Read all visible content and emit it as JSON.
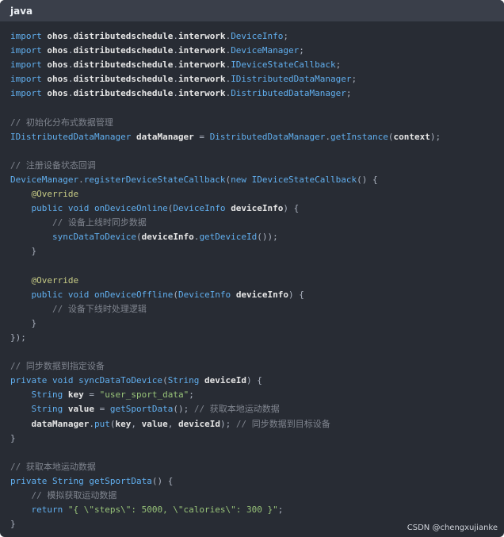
{
  "lang_label": "java",
  "watermark": "CSDN @chengxujianke",
  "code_lines": [
    [
      [
        "kw2",
        "import "
      ],
      [
        "pkg",
        "ohos"
      ],
      [
        "plain",
        "."
      ],
      [
        "pkg",
        "distributedschedule"
      ],
      [
        "plain",
        "."
      ],
      [
        "pkg",
        "interwork"
      ],
      [
        "plain",
        "."
      ],
      [
        "type",
        "DeviceInfo"
      ],
      [
        "plain",
        ";"
      ]
    ],
    [
      [
        "kw2",
        "import "
      ],
      [
        "pkg",
        "ohos"
      ],
      [
        "plain",
        "."
      ],
      [
        "pkg",
        "distributedschedule"
      ],
      [
        "plain",
        "."
      ],
      [
        "pkg",
        "interwork"
      ],
      [
        "plain",
        "."
      ],
      [
        "type",
        "DeviceManager"
      ],
      [
        "plain",
        ";"
      ]
    ],
    [
      [
        "kw2",
        "import "
      ],
      [
        "pkg",
        "ohos"
      ],
      [
        "plain",
        "."
      ],
      [
        "pkg",
        "distributedschedule"
      ],
      [
        "plain",
        "."
      ],
      [
        "pkg",
        "interwork"
      ],
      [
        "plain",
        "."
      ],
      [
        "type",
        "IDeviceStateCallback"
      ],
      [
        "plain",
        ";"
      ]
    ],
    [
      [
        "kw2",
        "import "
      ],
      [
        "pkg",
        "ohos"
      ],
      [
        "plain",
        "."
      ],
      [
        "pkg",
        "distributedschedule"
      ],
      [
        "plain",
        "."
      ],
      [
        "pkg",
        "interwork"
      ],
      [
        "plain",
        "."
      ],
      [
        "type",
        "IDistributedDataManager"
      ],
      [
        "plain",
        ";"
      ]
    ],
    [
      [
        "kw2",
        "import "
      ],
      [
        "pkg",
        "ohos"
      ],
      [
        "plain",
        "."
      ],
      [
        "pkg",
        "distributedschedule"
      ],
      [
        "plain",
        "."
      ],
      [
        "pkg",
        "interwork"
      ],
      [
        "plain",
        "."
      ],
      [
        "type",
        "DistributedDataManager"
      ],
      [
        "plain",
        ";"
      ]
    ],
    [],
    [
      [
        "com",
        "// 初始化分布式数据管理"
      ]
    ],
    [
      [
        "type",
        "IDistributedDataManager "
      ],
      [
        "var",
        "dataManager"
      ],
      [
        "plain",
        " = "
      ],
      [
        "type",
        "DistributedDataManager"
      ],
      [
        "plain",
        "."
      ],
      [
        "fn",
        "getInstance"
      ],
      [
        "plain",
        "("
      ],
      [
        "var",
        "context"
      ],
      [
        "plain",
        ");"
      ]
    ],
    [],
    [
      [
        "com",
        "// 注册设备状态回调"
      ]
    ],
    [
      [
        "type",
        "DeviceManager"
      ],
      [
        "plain",
        "."
      ],
      [
        "fn",
        "registerDeviceStateCallback"
      ],
      [
        "plain",
        "("
      ],
      [
        "kw2",
        "new "
      ],
      [
        "type",
        "IDeviceStateCallback"
      ],
      [
        "plain",
        "() {"
      ]
    ],
    [
      [
        "plain",
        "    "
      ],
      [
        "ann",
        "@Override"
      ]
    ],
    [
      [
        "plain",
        "    "
      ],
      [
        "kw2",
        "public void "
      ],
      [
        "fn",
        "onDeviceOnline"
      ],
      [
        "plain",
        "("
      ],
      [
        "type",
        "DeviceInfo "
      ],
      [
        "var",
        "deviceInfo"
      ],
      [
        "plain",
        ") {"
      ]
    ],
    [
      [
        "plain",
        "        "
      ],
      [
        "com",
        "// 设备上线时同步数据"
      ]
    ],
    [
      [
        "plain",
        "        "
      ],
      [
        "fn",
        "syncDataToDevice"
      ],
      [
        "plain",
        "("
      ],
      [
        "var",
        "deviceInfo"
      ],
      [
        "plain",
        "."
      ],
      [
        "fn",
        "getDeviceId"
      ],
      [
        "plain",
        "());"
      ]
    ],
    [
      [
        "plain",
        "    }"
      ]
    ],
    [],
    [
      [
        "plain",
        "    "
      ],
      [
        "ann",
        "@Override"
      ]
    ],
    [
      [
        "plain",
        "    "
      ],
      [
        "kw2",
        "public void "
      ],
      [
        "fn",
        "onDeviceOffline"
      ],
      [
        "plain",
        "("
      ],
      [
        "type",
        "DeviceInfo "
      ],
      [
        "var",
        "deviceInfo"
      ],
      [
        "plain",
        ") {"
      ]
    ],
    [
      [
        "plain",
        "        "
      ],
      [
        "com",
        "// 设备下线时处理逻辑"
      ]
    ],
    [
      [
        "plain",
        "    }"
      ]
    ],
    [
      [
        "plain",
        "});"
      ]
    ],
    [],
    [
      [
        "com",
        "// 同步数据到指定设备"
      ]
    ],
    [
      [
        "kw2",
        "private void "
      ],
      [
        "fn",
        "syncDataToDevice"
      ],
      [
        "plain",
        "("
      ],
      [
        "type",
        "String "
      ],
      [
        "var",
        "deviceId"
      ],
      [
        "plain",
        ") {"
      ]
    ],
    [
      [
        "plain",
        "    "
      ],
      [
        "type",
        "String "
      ],
      [
        "var",
        "key"
      ],
      [
        "plain",
        " = "
      ],
      [
        "str",
        "\"user_sport_data\""
      ],
      [
        "plain",
        ";"
      ]
    ],
    [
      [
        "plain",
        "    "
      ],
      [
        "type",
        "String "
      ],
      [
        "var",
        "value"
      ],
      [
        "plain",
        " = "
      ],
      [
        "fn",
        "getSportData"
      ],
      [
        "plain",
        "(); "
      ],
      [
        "com",
        "// 获取本地运动数据"
      ]
    ],
    [
      [
        "plain",
        "    "
      ],
      [
        "var",
        "dataManager"
      ],
      [
        "plain",
        "."
      ],
      [
        "fn",
        "put"
      ],
      [
        "plain",
        "("
      ],
      [
        "var",
        "key"
      ],
      [
        "plain",
        ", "
      ],
      [
        "var",
        "value"
      ],
      [
        "plain",
        ", "
      ],
      [
        "var",
        "deviceId"
      ],
      [
        "plain",
        "); "
      ],
      [
        "com",
        "// 同步数据到目标设备"
      ]
    ],
    [
      [
        "plain",
        "}"
      ]
    ],
    [],
    [
      [
        "com",
        "// 获取本地运动数据"
      ]
    ],
    [
      [
        "kw2",
        "private "
      ],
      [
        "type",
        "String "
      ],
      [
        "fn",
        "getSportData"
      ],
      [
        "plain",
        "() {"
      ]
    ],
    [
      [
        "plain",
        "    "
      ],
      [
        "com",
        "// 模拟获取运动数据"
      ]
    ],
    [
      [
        "plain",
        "    "
      ],
      [
        "kw2",
        "return "
      ],
      [
        "str",
        "\"{ \\\"steps\\\": 5000, \\\"calories\\\": 300 }\""
      ],
      [
        "plain",
        ";"
      ]
    ],
    [
      [
        "plain",
        "}"
      ]
    ]
  ]
}
